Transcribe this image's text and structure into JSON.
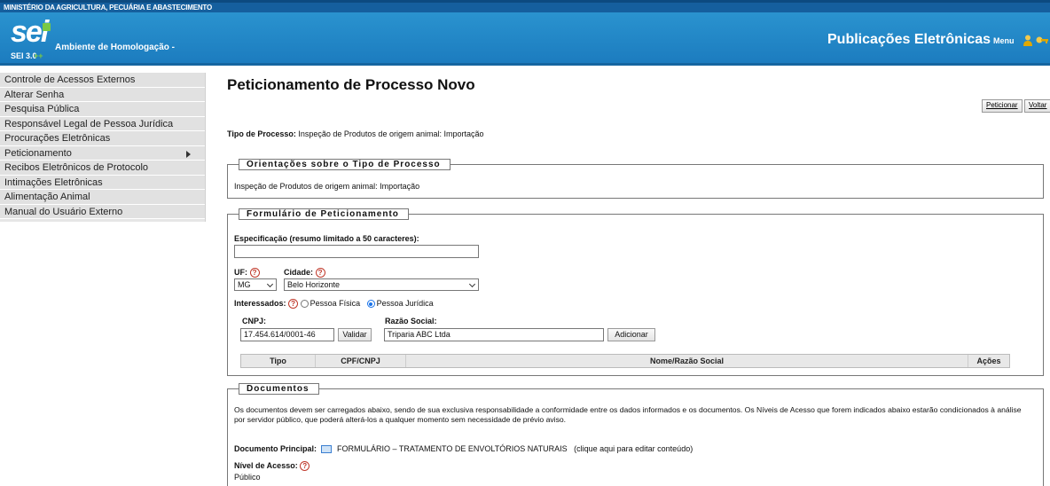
{
  "topbar": {
    "org": "MINISTÉRIO DA AGRICULTURA, PECUÁRIA E ABASTECIMENTO"
  },
  "header": {
    "logo": "sei",
    "environment": "Ambiente de Homologação -",
    "version": "SEI 3.0",
    "version_plus": "++",
    "title": "Publicações Eletrônicas",
    "menu_label": "Menu",
    "icons": [
      "user-icon",
      "key-icon"
    ],
    "colors": {
      "bar": "#155f9e",
      "header": "#2a93cf",
      "accent": "#7ac943"
    }
  },
  "sidebar": {
    "items": [
      {
        "label": "Controle de Acessos Externos"
      },
      {
        "label": "Alterar Senha"
      },
      {
        "label": "Pesquisa Pública"
      },
      {
        "label": "Responsável Legal de Pessoa Jurídica"
      },
      {
        "label": "Procurações Eletrônicas"
      },
      {
        "label": "Peticionamento",
        "has_submenu": true
      },
      {
        "label": "Recibos Eletrônicos de Protocolo"
      },
      {
        "label": "Intimações Eletrônicas"
      },
      {
        "label": "Alimentação Animal"
      },
      {
        "label": "Manual do Usuário Externo"
      }
    ]
  },
  "main": {
    "title": "Peticionamento de Processo Novo",
    "buttons": {
      "peticionar": "Peticionar",
      "voltar": "Voltar"
    },
    "tipo": {
      "label": "Tipo de Processo:",
      "value": "Inspeção de Produtos de origem animal: Importação"
    },
    "orientacoes": {
      "legend": "Orientações sobre o Tipo de Processo",
      "text": "Inspeção de Produtos de origem animal: Importação"
    },
    "form": {
      "legend": "Formulário de Peticionamento",
      "especificacao_label": "Especificação (resumo limitado a 50 caracteres):",
      "especificacao_value": "",
      "uf_label": "UF:",
      "uf_value": "MG",
      "cidade_label": "Cidade:",
      "cidade_value": "Belo Horizonte",
      "interessados_label": "Interessados:",
      "pessoa_fisica": "Pessoa Física",
      "pessoa_juridica": "Pessoa Jurídica",
      "selected_type": "Pessoa Jurídica",
      "cnpj_label": "CNPJ:",
      "cnpj_value": "17.454.614/0001-46",
      "validar": "Validar",
      "razao_label": "Razão Social:",
      "razao_value": "Triparia ABC Ltda",
      "adicionar": "Adicionar",
      "table_headers": [
        "Tipo",
        "CPF/CNPJ",
        "Nome/Razão Social",
        "Ações"
      ]
    },
    "documentos": {
      "legend": "Documentos",
      "text": "Os documentos devem ser carregados abaixo, sendo de sua exclusiva responsabilidade a conformidade entre os dados informados e os documentos. Os Níveis de Acesso que forem indicados abaixo estarão condicionados à análise por servidor público, que poderá alterá-los a qualquer momento sem necessidade de prévio aviso.",
      "principal_label": "Documento Principal:",
      "principal_name": "FORMULÁRIO – TRATAMENTO DE ENVOLTÓRIOS NATURAIS",
      "principal_hint": "(clique aqui para editar conteúdo)",
      "nivel_label": "Nível de Acesso:",
      "nivel_value": "Público"
    }
  }
}
